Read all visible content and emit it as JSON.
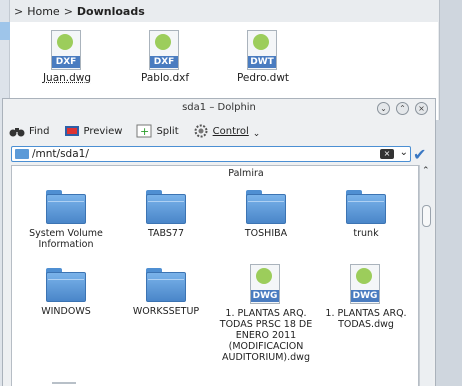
{
  "back_window": {
    "breadcrumb": [
      {
        "label": "Home"
      },
      {
        "label": "Downloads"
      }
    ],
    "files": [
      {
        "name": "Juan.dwg",
        "ext": "DXF"
      },
      {
        "name": "Pablo.dxf",
        "ext": "DXF"
      },
      {
        "name": "Pedro.dwt",
        "ext": "DWT"
      }
    ]
  },
  "dolphin": {
    "title": "sda1 – Dolphin",
    "toolbar": {
      "find": "Find",
      "preview": "Preview",
      "split": "Split",
      "control": "Control"
    },
    "location": {
      "path": "/mnt/sda1/"
    },
    "partial_top_label": "Palmira",
    "items": [
      {
        "type": "folder",
        "label": "System Volume Information"
      },
      {
        "type": "folder",
        "label": "TABS77"
      },
      {
        "type": "folder",
        "label": "TOSHIBA"
      },
      {
        "type": "folder",
        "label": "trunk"
      },
      {
        "type": "folder",
        "label": "WINDOWS"
      },
      {
        "type": "folder",
        "label": "WORKSSETUP"
      },
      {
        "type": "file",
        "ext": "DWG",
        "label": "1. PLANTAS ARQ. TODAS PRSC 18 DE ENERO 2011 (MODIFICACION AUDITORIUM).dwg"
      },
      {
        "type": "file",
        "ext": "DWG",
        "label": "1. PLANTAS ARQ. TODAS.dwg"
      }
    ]
  },
  "colors": {
    "accent": "#4b8fd3",
    "folder": "#5b9ad8",
    "dwg_badge": "#4a7cc0"
  }
}
